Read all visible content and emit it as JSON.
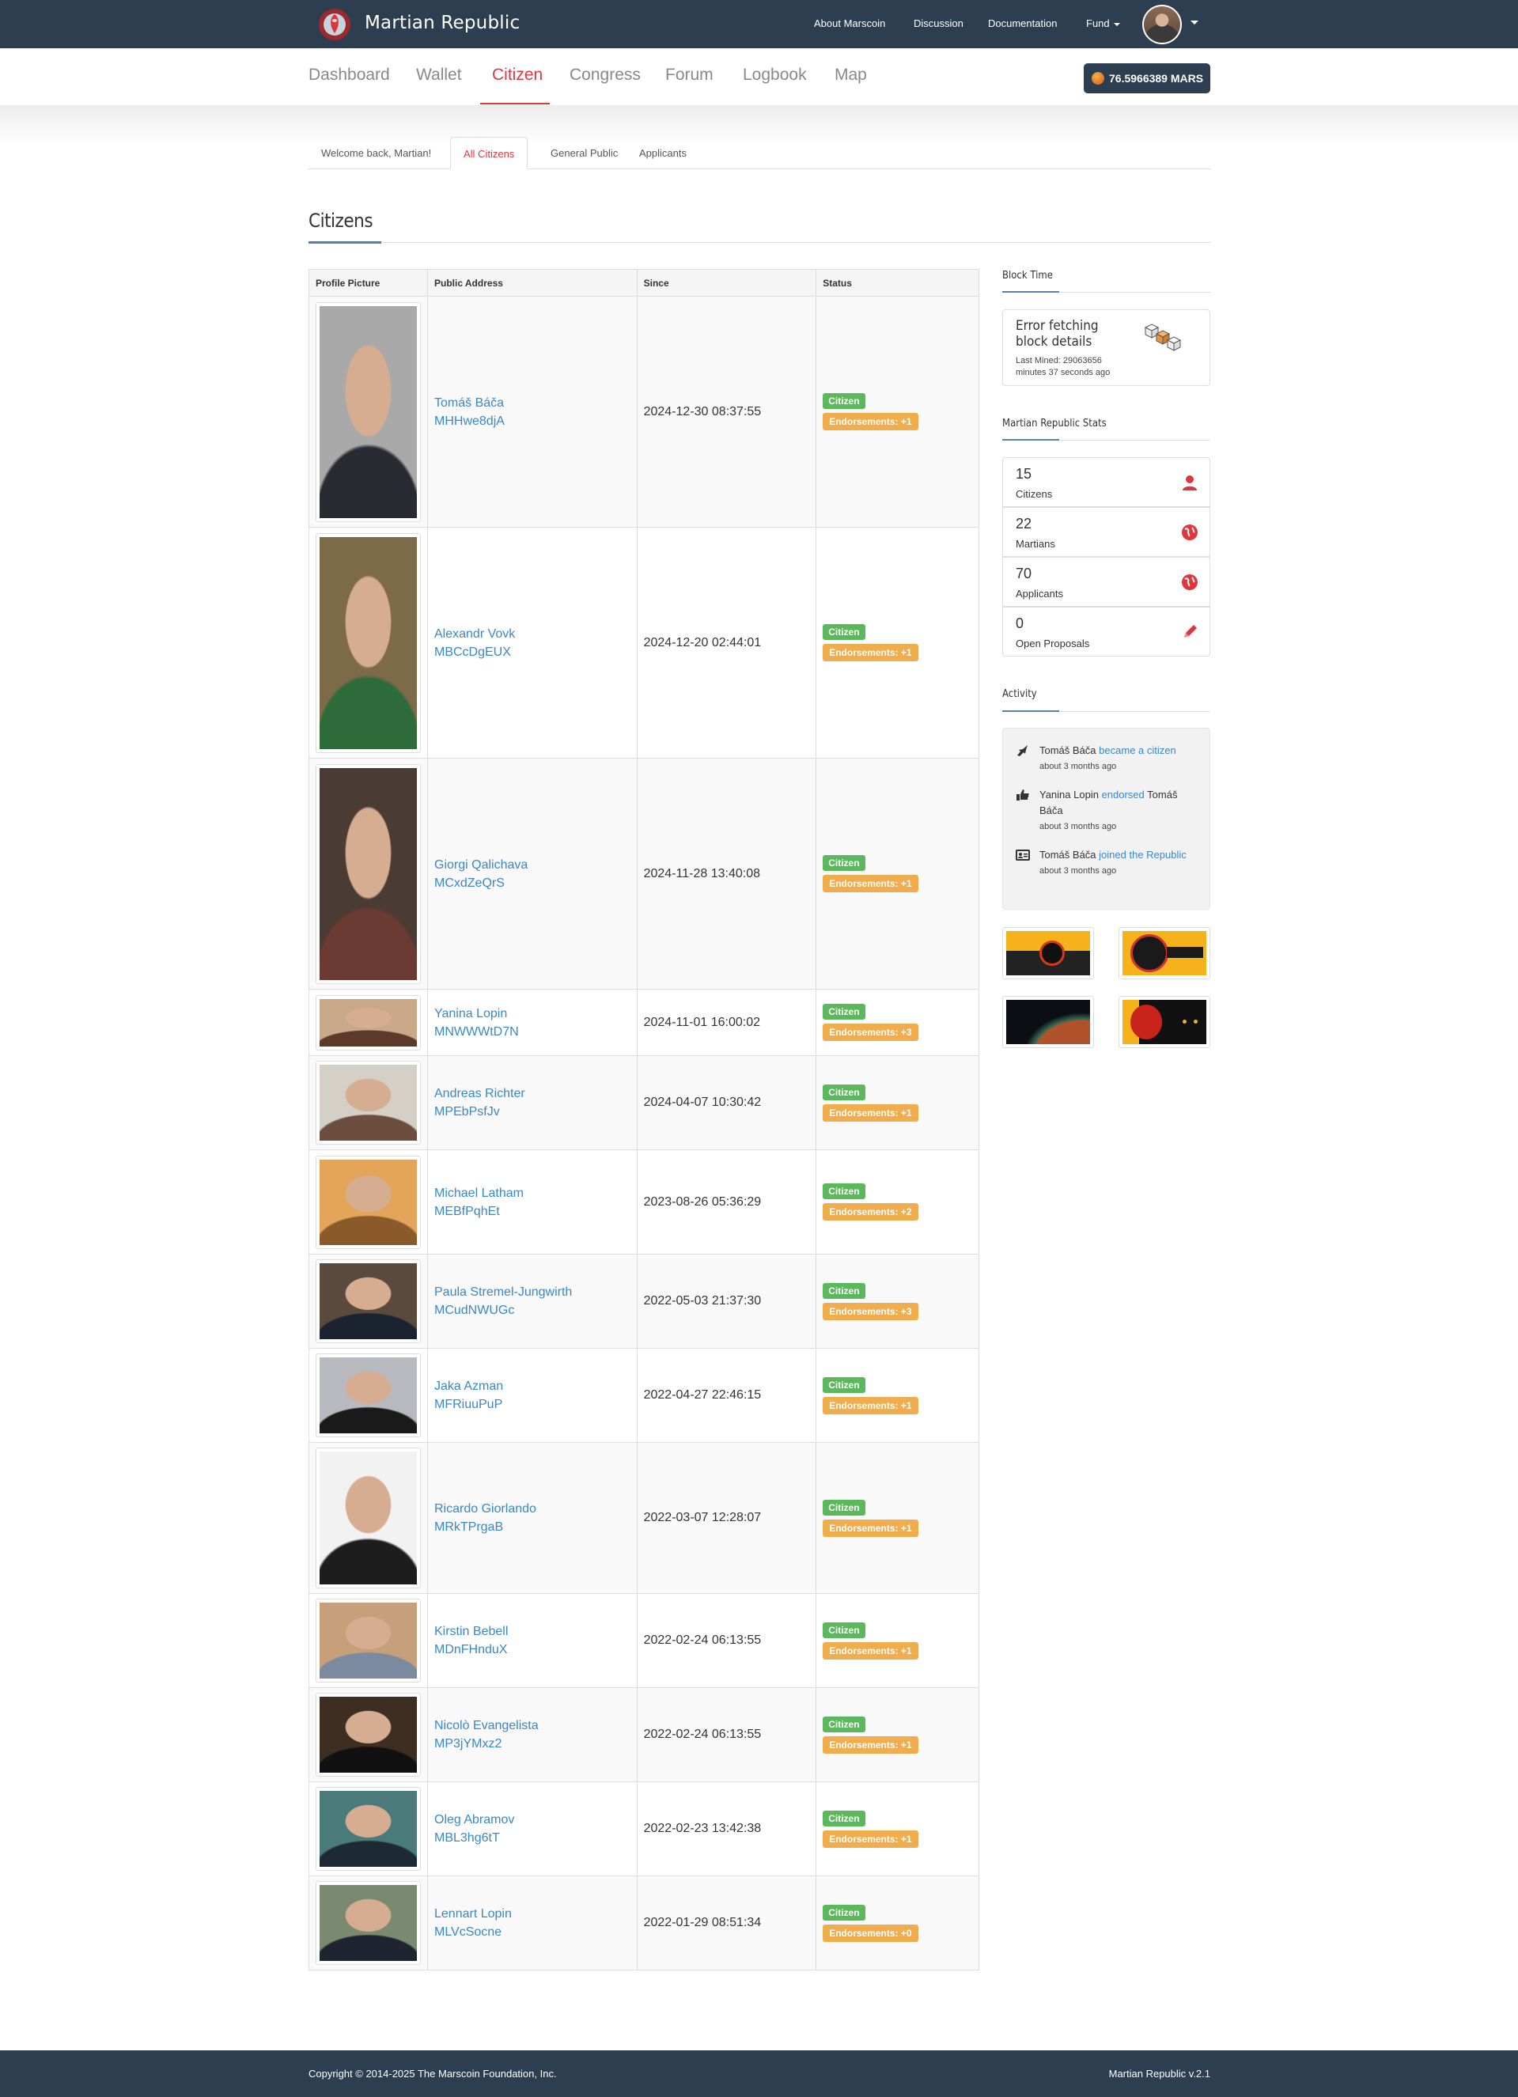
{
  "app": {
    "brand": "Martian Republic"
  },
  "topnav": {
    "items": [
      "About Marscoin",
      "Discussion",
      "Documentation",
      "Fund"
    ]
  },
  "mainnav": {
    "items": [
      "Dashboard",
      "Wallet",
      "Citizen",
      "Congress",
      "Forum",
      "Logbook",
      "Map"
    ],
    "active": "Citizen"
  },
  "balance": "76.5966389 MARS",
  "subtabs": {
    "items": [
      "Welcome back, Martian!",
      "All Citizens",
      "General Public",
      "Applicants"
    ],
    "active": "All Citizens"
  },
  "section_title": "Citizens",
  "table": {
    "headers": [
      "Profile Picture",
      "Public Address",
      "Since",
      "Status"
    ],
    "rows": [
      {
        "name": "Tomáš Báča",
        "address": "MHHwe8djA",
        "since": "2024-12-30 08:37:55",
        "status": "Citizen",
        "endorsements": "Endorsements: +1"
      },
      {
        "name": "Alexandr Vovk",
        "address": "MBCcDgEUX",
        "since": "2024-12-20 02:44:01",
        "status": "Citizen",
        "endorsements": "Endorsements: +1"
      },
      {
        "name": "Giorgi Qalichava",
        "address": "MCxdZeQrS",
        "since": "2024-11-28 13:40:08",
        "status": "Citizen",
        "endorsements": "Endorsements: +1"
      },
      {
        "name": "Yanina Lopin",
        "address": "MNWWWtD7N",
        "since": "2024-11-01 16:00:02",
        "status": "Citizen",
        "endorsements": "Endorsements: +3"
      },
      {
        "name": "Andreas Richter",
        "address": "MPEbPsfJv",
        "since": "2024-04-07 10:30:42",
        "status": "Citizen",
        "endorsements": "Endorsements: +1"
      },
      {
        "name": "Michael Latham",
        "address": "MEBfPqhEt",
        "since": "2023-08-26 05:36:29",
        "status": "Citizen",
        "endorsements": "Endorsements: +2"
      },
      {
        "name": "Paula Stremel-Jungwirth",
        "address": "MCudNWUGc",
        "since": "2022-05-03 21:37:30",
        "status": "Citizen",
        "endorsements": "Endorsements: +3"
      },
      {
        "name": "Jaka Azman",
        "address": "MFRiuuPuP",
        "since": "2022-04-27 22:46:15",
        "status": "Citizen",
        "endorsements": "Endorsements: +1"
      },
      {
        "name": "Ricardo Giorlando",
        "address": "MRkTPrgaB",
        "since": "2022-03-07 12:28:07",
        "status": "Citizen",
        "endorsements": "Endorsements: +1"
      },
      {
        "name": "Kirstin Bebell",
        "address": "MDnFHnduX",
        "since": "2022-02-24 06:13:55",
        "status": "Citizen",
        "endorsements": "Endorsements: +1"
      },
      {
        "name": "Nicolò Evangelista",
        "address": "MP3jYMxz2",
        "since": "2022-02-24 06:13:55",
        "status": "Citizen",
        "endorsements": "Endorsements: +1"
      },
      {
        "name": "Oleg Abramov",
        "address": "MBL3hg6tT",
        "since": "2022-02-23 13:42:38",
        "status": "Citizen",
        "endorsements": "Endorsements: +1"
      },
      {
        "name": "Lennart Lopin",
        "address": "MLVcSocne",
        "since": "2022-01-29 08:51:34",
        "status": "Citizen",
        "endorsements": "Endorsements: +0"
      }
    ]
  },
  "sidebar": {
    "block_time": {
      "heading": "Block Time",
      "error": "Error fetching block details",
      "last_mined": "Last Mined: 29063656",
      "ago": "minutes 37 seconds ago"
    },
    "stats": {
      "heading": "Martian Republic Stats",
      "items": [
        {
          "num": "15",
          "label": "Citizens",
          "icon": "user-icon"
        },
        {
          "num": "22",
          "label": "Martians",
          "icon": "globe-icon"
        },
        {
          "num": "70",
          "label": "Applicants",
          "icon": "globe-icon"
        },
        {
          "num": "0",
          "label": "Open Proposals",
          "icon": "pencil-icon"
        }
      ]
    },
    "activity": {
      "heading": "Activity",
      "items": [
        {
          "actor": "Tomáš Báča",
          "action": "became a citizen",
          "tail": "",
          "time": "about 3 months ago",
          "icon": "rocket-icon"
        },
        {
          "actor": "Yanina Lopin",
          "action": "endorsed",
          "tail": "Tomáš Báča",
          "time": "about 3 months ago",
          "icon": "thumbs-up-icon"
        },
        {
          "actor": "Tomáš Báča",
          "action": "joined the Republic",
          "tail": "",
          "time": "about 3 months ago",
          "icon": "id-card-icon"
        }
      ]
    }
  },
  "footer": {
    "copyright": "Copyright © 2014-2025 The Marscoin Foundation, Inc.",
    "version": "Martian Republic v.2.1"
  },
  "colors": {
    "navbar": "#2c3e50",
    "accent": "#e0373e",
    "link": "#3a87c8",
    "citizen": "#5cb85c",
    "endorse": "#f0ad4e"
  }
}
